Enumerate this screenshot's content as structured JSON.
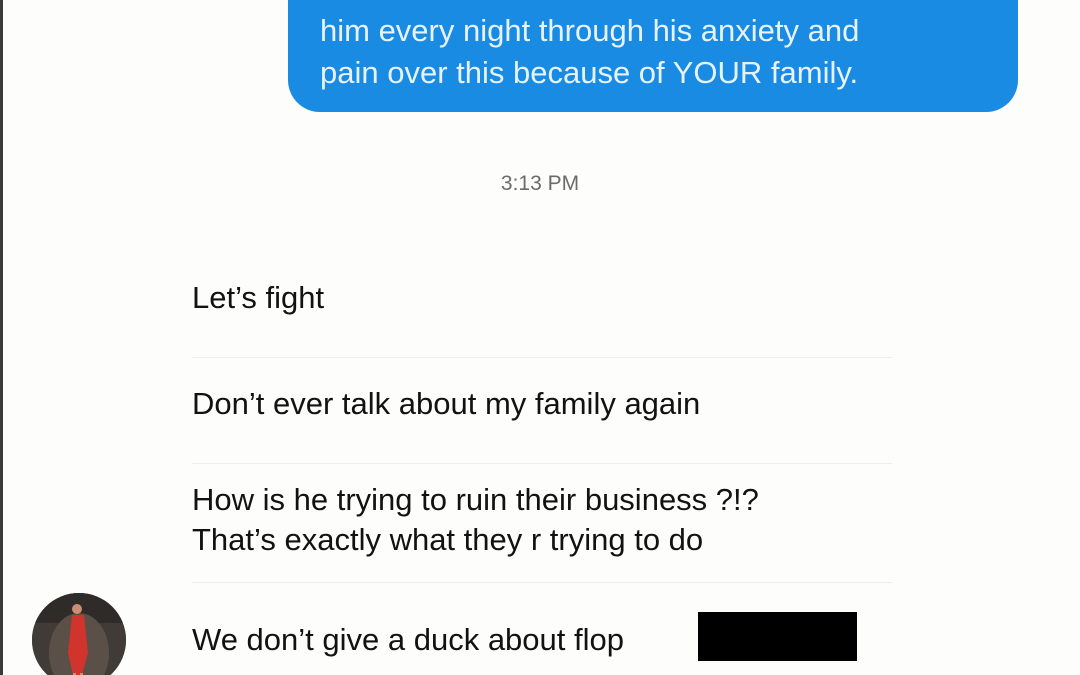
{
  "conversation": {
    "sent_message": {
      "lines": [
        "him every night through his anxiety and",
        "pain over this because of YOUR family."
      ]
    },
    "timestamp": "3:13 PM",
    "received_messages": [
      {
        "lines": [
          "Let’s fight"
        ]
      },
      {
        "lines": [
          "Don’t ever talk about my family again"
        ]
      },
      {
        "lines": [
          "How is he trying to ruin their business ?!?",
          "That’s exactly what they r trying to do"
        ]
      },
      {
        "lines": [
          "We don’t give a duck about flop"
        ]
      }
    ]
  },
  "colors": {
    "sent_bubble": "#1a8be2",
    "sent_text": "#e6f3ff",
    "received_text": "#121212",
    "timestamp_text": "#6b6b6b",
    "redaction": "#000000"
  },
  "icons": {
    "avatar": "avatar-photo-person-in-red"
  }
}
